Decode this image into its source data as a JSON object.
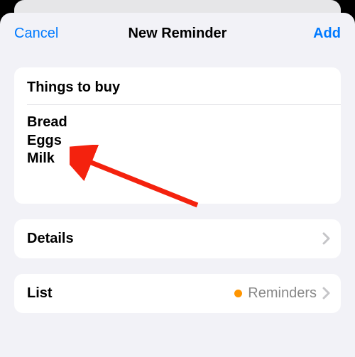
{
  "nav": {
    "cancel_label": "Cancel",
    "title": "New Reminder",
    "add_label": "Add"
  },
  "reminder": {
    "title_value": "Things to buy",
    "notes_value": "Bread\nEggs\nMilk"
  },
  "rows": {
    "details": {
      "label": "Details"
    },
    "list": {
      "label": "List",
      "value": "Reminders",
      "dot_color": "#ff9500"
    }
  },
  "colors": {
    "ios_blue": "#007aff"
  }
}
